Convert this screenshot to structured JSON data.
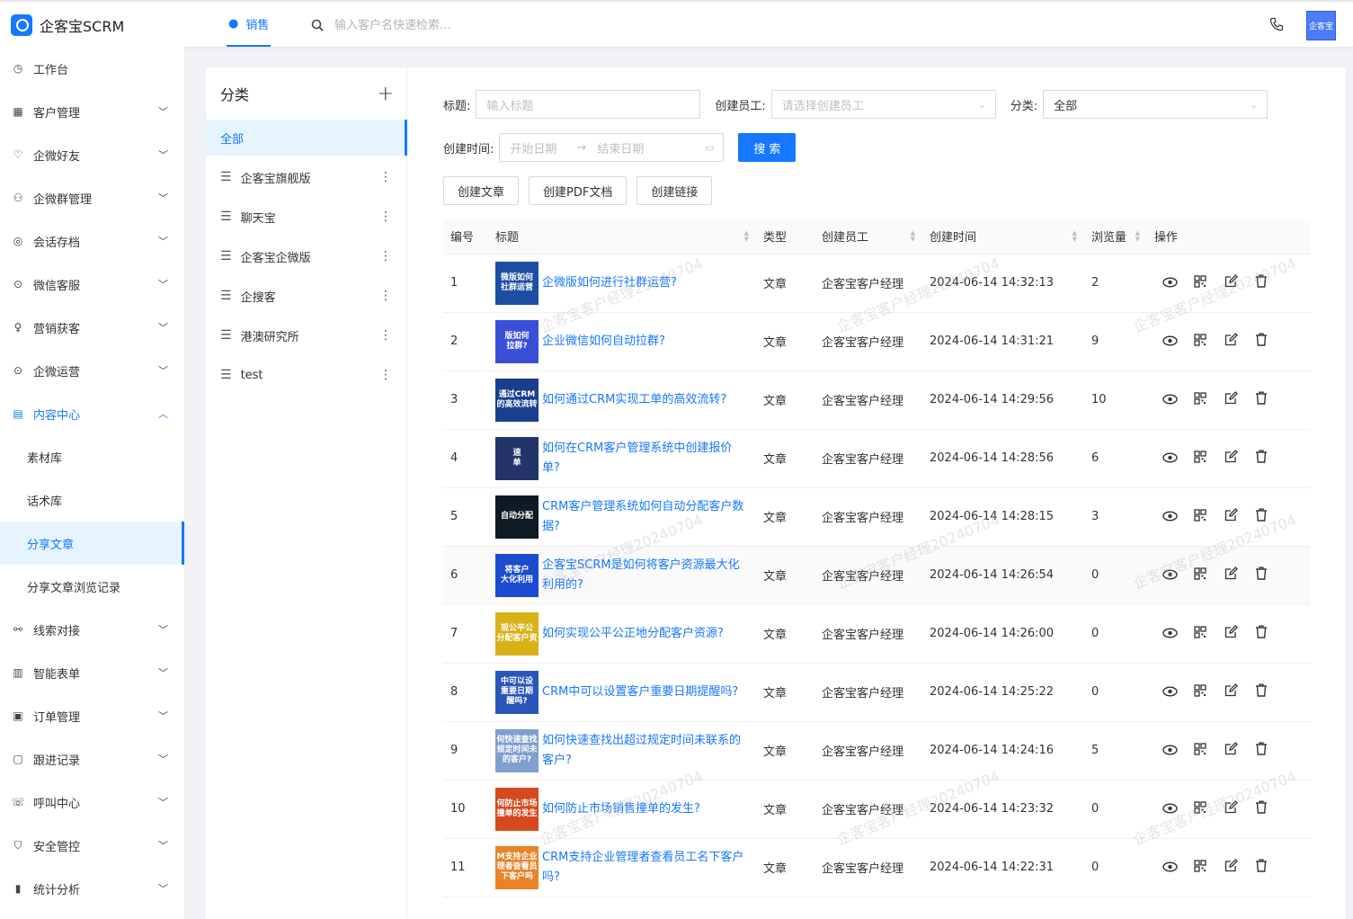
{
  "app": {
    "logo_text": "企客宝SCRM",
    "top_tab": "销售",
    "search_placeholder": "输入客户名快速检索...",
    "avatar_text": "企客宝"
  },
  "sidebar": {
    "items": [
      {
        "label": "工作台",
        "icon": "dashboard-icon",
        "chevron": ""
      },
      {
        "label": "客户管理",
        "icon": "building-icon",
        "chevron": "⌄"
      },
      {
        "label": "企微好友",
        "icon": "friend-icon",
        "chevron": "⌄"
      },
      {
        "label": "企微群管理",
        "icon": "group-icon",
        "chevron": "⌄"
      },
      {
        "label": "会话存档",
        "icon": "chat-icon",
        "chevron": "⌄"
      },
      {
        "label": "微信客服",
        "icon": "service-icon",
        "chevron": "⌄"
      },
      {
        "label": "营销获客",
        "icon": "bulb-icon",
        "chevron": "⌄"
      },
      {
        "label": "企微运营",
        "icon": "operation-icon",
        "chevron": "⌄"
      },
      {
        "label": "内容中心",
        "icon": "content-icon",
        "chevron": "⌃"
      }
    ],
    "sub_items": [
      {
        "label": "素材库"
      },
      {
        "label": "话术库"
      },
      {
        "label": "分享文章"
      },
      {
        "label": "分享文章浏览记录"
      }
    ],
    "items_after": [
      {
        "label": "线索对接",
        "icon": "link-icon"
      },
      {
        "label": "智能表单",
        "icon": "form-icon"
      },
      {
        "label": "订单管理",
        "icon": "order-icon"
      },
      {
        "label": "跟进记录",
        "icon": "record-icon"
      },
      {
        "label": "呼叫中心",
        "icon": "phone-icon"
      },
      {
        "label": "安全管控",
        "icon": "shield-icon"
      },
      {
        "label": "统计分析",
        "icon": "chart-icon"
      }
    ]
  },
  "categories": {
    "title": "分类",
    "all": "全部",
    "items": [
      "企客宝旗舰版",
      "聊天宝",
      "企客宝企微版",
      "企搜客",
      "港澳研究所",
      "test"
    ]
  },
  "filters": {
    "title_label": "标题:",
    "title_placeholder": "输入标题",
    "creator_label": "创建员工:",
    "creator_placeholder": "请选择创建员工",
    "category_label": "分类:",
    "category_value": "全部",
    "time_label": "创建时间:",
    "start_placeholder": "开始日期",
    "end_placeholder": "结束日期",
    "search_button": "搜索"
  },
  "actions": {
    "create_article": "创建文章",
    "create_pdf": "创建PDF文档",
    "create_link": "创建链接"
  },
  "table": {
    "headers": {
      "id": "编号",
      "title": "标题",
      "type": "类型",
      "creator": "创建员工",
      "time": "创建时间",
      "views": "浏览量",
      "ops": "操作"
    },
    "rows": [
      {
        "id": "1",
        "title": "企微版如何进行社群运营?",
        "type": "文章",
        "creator": "企客宝客户经理",
        "time": "2024-06-14 14:32:13",
        "views": "2",
        "thumb": "微版如何\n社群运营",
        "thumb_bg": "#1c4fa3"
      },
      {
        "id": "2",
        "title": "企业微信如何自动拉群?",
        "type": "文章",
        "creator": "企客宝客户经理",
        "time": "2024-06-14 14:31:21",
        "views": "9",
        "thumb": "版如何\n拉群?",
        "thumb_bg": "#3a4fd8"
      },
      {
        "id": "3",
        "title": "如何通过CRM实现工单的高效流转?",
        "type": "文章",
        "creator": "企客宝客户经理",
        "time": "2024-06-14 14:29:56",
        "views": "10",
        "thumb": "通过CRM\n的高效流转",
        "thumb_bg": "#1a3f8f"
      },
      {
        "id": "4",
        "title": "如何在CRM客户管理系统中创建报价单?",
        "type": "文章",
        "creator": "企客宝客户经理",
        "time": "2024-06-14 14:28:56",
        "views": "6",
        "thumb": "速\n单",
        "thumb_bg": "#23346b"
      },
      {
        "id": "5",
        "title": "CRM客户管理系统如何自动分配客户数据?",
        "type": "文章",
        "creator": "企客宝客户经理",
        "time": "2024-06-14 14:28:15",
        "views": "3",
        "thumb": "自动分配",
        "thumb_bg": "#0e1a24"
      },
      {
        "id": "6",
        "title": "企客宝SCRM是如何将客户资源最大化利用的?",
        "type": "文章",
        "creator": "企客宝客户经理",
        "time": "2024-06-14 14:26:54",
        "views": "0",
        "thumb": "将客户\n大化利用",
        "thumb_bg": "#1b4ccf"
      },
      {
        "id": "7",
        "title": "如何实现公平公正地分配客户资源?",
        "type": "文章",
        "creator": "企客宝客户经理",
        "time": "2024-06-14 14:26:00",
        "views": "0",
        "thumb": "现公平公\n分配客户资",
        "thumb_bg": "#d9b21a"
      },
      {
        "id": "8",
        "title": "CRM中可以设置客户重要日期提醒吗?",
        "type": "文章",
        "creator": "企客宝客户经理",
        "time": "2024-06-14 14:25:22",
        "views": "0",
        "thumb": "中可以设\n重要日期\n醒吗?",
        "thumb_bg": "#2a56b8"
      },
      {
        "id": "9",
        "title": "如何快速查找出超过规定时间未联系的客户?",
        "type": "文章",
        "creator": "企客宝客户经理",
        "time": "2024-06-14 14:24:16",
        "views": "5",
        "thumb": "何快速查找\n规定时间未\n的客户?",
        "thumb_bg": "#7f9fd0"
      },
      {
        "id": "10",
        "title": "如何防止市场销售撞单的发生?",
        "type": "文章",
        "creator": "企客宝客户经理",
        "time": "2024-06-14 14:23:32",
        "views": "0",
        "thumb": "何防止市场\n撞单的发生",
        "thumb_bg": "#d44a1e"
      },
      {
        "id": "11",
        "title": "CRM支持企业管理者查看员工名下客户吗?",
        "type": "文章",
        "creator": "企客宝客户经理",
        "time": "2024-06-14 14:22:31",
        "views": "0",
        "thumb": "M支持企业\n理者查看员\n下客户吗",
        "thumb_bg": "#e8832a"
      }
    ]
  },
  "watermark": "企客宝客户经理20240704",
  "colors": {
    "primary": "#1677ff",
    "active_bg": "#e6f4ff"
  }
}
